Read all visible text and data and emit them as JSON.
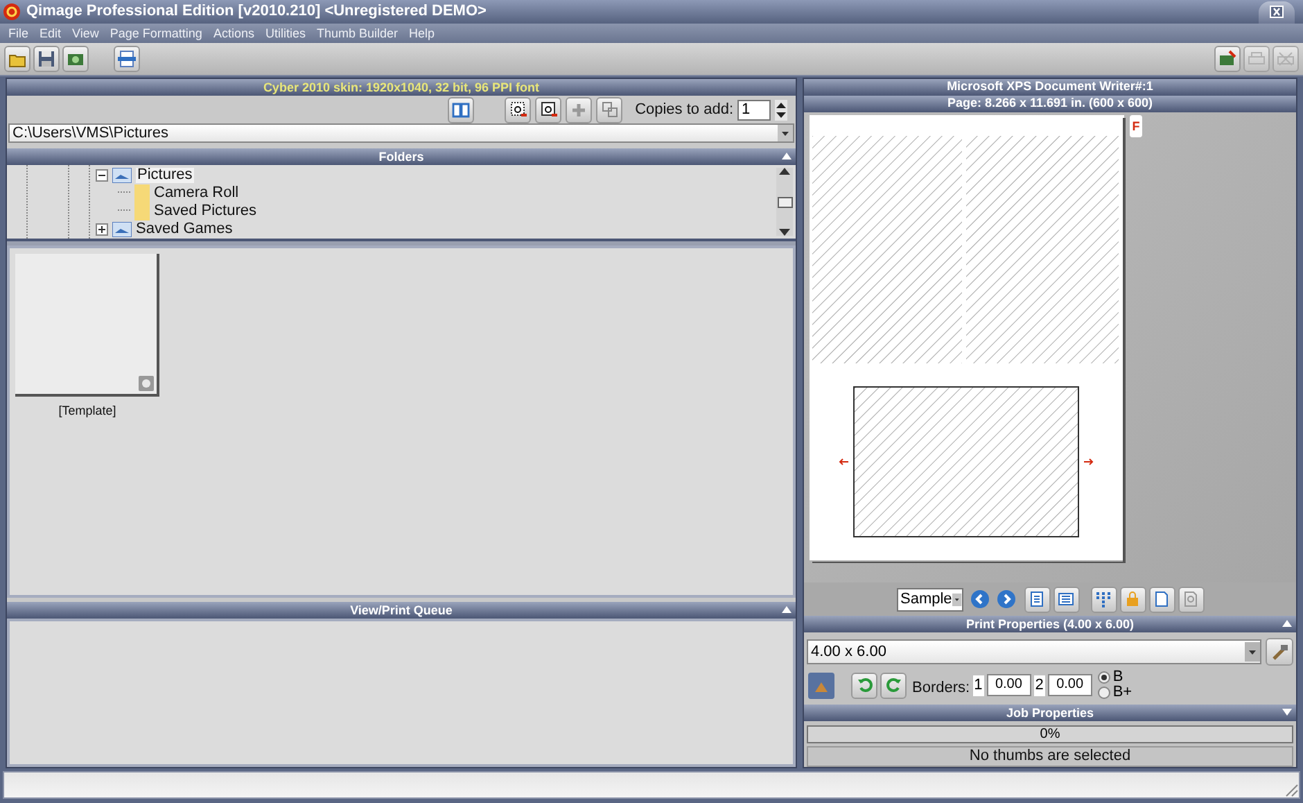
{
  "window": {
    "title": "Qimage Professional Edition [v2010.210] <Unregistered DEMO>"
  },
  "menu": [
    "File",
    "Edit",
    "View",
    "Page Formatting",
    "Actions",
    "Utilities",
    "Thumb Builder",
    "Help"
  ],
  "left_panel": {
    "header": "Cyber 2010 skin: 1920x1040, 32 bit, 96 PPI font",
    "copies_label": "Copies to add:",
    "copies_value": "1",
    "path": "C:\\Users\\VMS\\Pictures",
    "folders": {
      "title": "Folders",
      "tree": [
        {
          "label": "Pictures",
          "selected": true,
          "expanded": true,
          "children": [
            {
              "label": "Camera Roll",
              "selected": false
            },
            {
              "label": "Saved Pictures",
              "selected": false
            }
          ]
        },
        {
          "label": "Saved Games",
          "selected": false,
          "expanded": false
        }
      ]
    },
    "thumbnails": [
      {
        "caption": "[Template]"
      }
    ],
    "queue": {
      "title": "View/Print Queue"
    }
  },
  "right_panel": {
    "printer": "Microsoft XPS Document Writer#:1",
    "page_info": "Page: 8.266 x 11.691 in.  (600 x 600)",
    "page_tab": "F",
    "view_select": "Sample",
    "print_properties": {
      "title": "Print Properties (4.00 x 6.00)",
      "size": "4.00 x 6.00",
      "borders_label": "Borders:",
      "borders": [
        {
          "label": "1",
          "value": "0.00"
        },
        {
          "label": "2",
          "value": "0.00"
        }
      ],
      "options": [
        {
          "label": "B",
          "selected": true
        },
        {
          "label": "B+",
          "selected": false
        }
      ]
    },
    "job_properties": {
      "title": "Job Properties",
      "level": 0,
      "reading": "0%",
      "status": "No thumbs are selected"
    }
  }
}
